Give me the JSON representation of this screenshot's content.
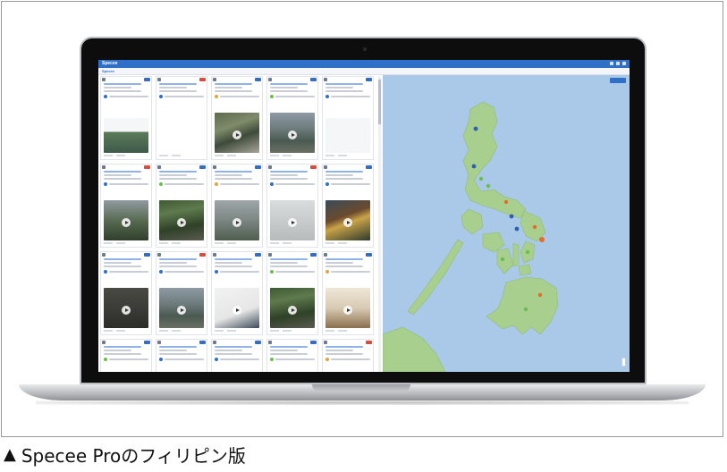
{
  "caption": {
    "marker": "▲",
    "text": "Specee Proのフィリピン版"
  },
  "app": {
    "logo": "Specee",
    "subbar_label": "Specee",
    "icons": [
      "bell-icon",
      "grid-icon",
      "user-icon"
    ]
  },
  "cards": [
    {
      "media": "none-doc",
      "badge": "#2f6fc7",
      "dot": "#2f6fc7"
    },
    {
      "media": "none",
      "badge": "#d94b3b",
      "dot": "#2f6fc7"
    },
    {
      "media": "m-street",
      "badge": "#2f6fc7",
      "dot": "#e0a63a"
    },
    {
      "media": "m-flood",
      "badge": "#2f6fc7",
      "dot": "#6abf4b"
    },
    {
      "media": "none-doc2",
      "badge": "#2f6fc7",
      "dot": "#2f6fc7"
    },
    {
      "media": "m-hill",
      "badge": "#d94b3b",
      "dot": "#2f6fc7"
    },
    {
      "media": "m-tree",
      "badge": "#2f6fc7",
      "dot": "#6abf4b"
    },
    {
      "media": "m-rain",
      "badge": "#2f6fc7",
      "dot": "#e0a63a"
    },
    {
      "media": "m-fog",
      "badge": "#d94b3b",
      "dot": "#2f6fc7"
    },
    {
      "media": "m-sign",
      "badge": "#2f6fc7",
      "dot": "#2f6fc7"
    },
    {
      "media": "m-dark",
      "badge": "#2f6fc7",
      "dot": "#2f6fc7"
    },
    {
      "media": "m-flood",
      "badge": "#d94b3b",
      "dot": "#2f6fc7"
    },
    {
      "media": "m-white",
      "badge": "#2f6fc7",
      "dot": "#2f6fc7"
    },
    {
      "media": "m-tree",
      "badge": "#2f6fc7",
      "dot": "#6abf4b"
    },
    {
      "media": "m-doc",
      "badge": "#2f6fc7",
      "dot": "#e0a63a"
    },
    {
      "media": "m-street",
      "badge": "#2f6fc7",
      "dot": "#6abf4b"
    },
    {
      "media": "m-dark",
      "badge": "#2f6fc7",
      "dot": "#2f6fc7"
    },
    {
      "media": "m-rain",
      "badge": "#2f6fc7",
      "dot": "#2f6fc7"
    },
    {
      "media": "m-street",
      "badge": "#2f6fc7",
      "dot": "#6abf4b"
    },
    {
      "media": "m-tree",
      "badge": "#d94b3b",
      "dot": "#e0a63a"
    }
  ],
  "map": {
    "sea_color": "#aac9e8",
    "land_color": "#a9cf8e",
    "marker_colors": [
      "#2f5fb0",
      "#e46d2a",
      "#6abf4b"
    ]
  }
}
